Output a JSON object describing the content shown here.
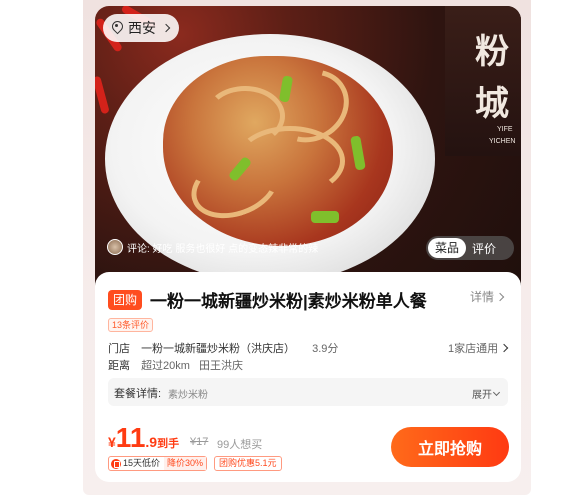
{
  "location": {
    "city": "西安"
  },
  "photo": {
    "review_text": "评论: 好吃 服务也很好 点的变态辣非常的辣",
    "toggle": {
      "active": "菜品",
      "inactive": "评价"
    },
    "sign": {
      "char1": "粉",
      "char2": "城",
      "small1": "YIFE",
      "small2": "YICHEN"
    }
  },
  "deal": {
    "badge": "团购",
    "title": "一粉一城新疆炒米粉|素炒米粉单人餐",
    "detail_link": "详情",
    "ratings_badge": "13条评价",
    "store_label": "门店",
    "store_name": "一粉一城新疆炒米粉（洪庆店）",
    "store_score": "3.9分",
    "stores_applicable": "1家店通用",
    "distance_label": "距离",
    "distance_value": "超过20km",
    "distance_area": "田王洪庆"
  },
  "package": {
    "label": "套餐详情:",
    "value": "素炒米粉",
    "expand": "展开"
  },
  "pricing": {
    "currency": "¥",
    "integer": "11",
    "decimal": ".9",
    "suffix": "到手",
    "original": "¥17",
    "wants": "99人想买"
  },
  "tags": {
    "lowprice_text": "15天低价",
    "lowprice_discount": "降价30%",
    "coupon": "团购优惠5.1元"
  },
  "buy_button": "立即抢购",
  "colors": {
    "accent": "#ff3b12",
    "badge": "#ff4d1f"
  }
}
